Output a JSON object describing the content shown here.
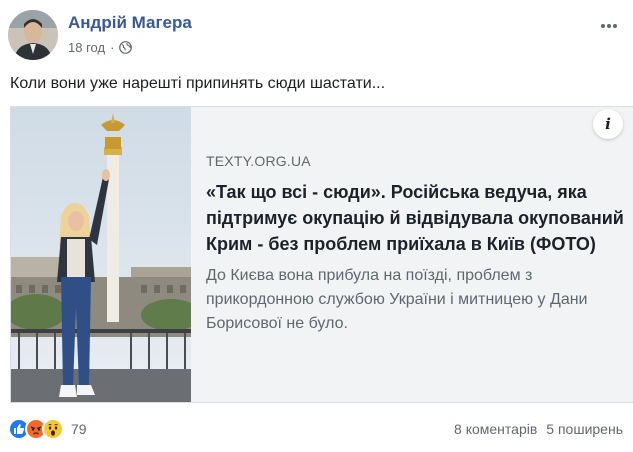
{
  "post": {
    "author": "Андрій Магера",
    "time": "18 год",
    "separator": "·",
    "audience_icon": "globe-icon",
    "more_icon": "more-options-icon",
    "text": "Коли вони уже нарешті припинять сюди шастати..."
  },
  "link_card": {
    "domain": "TEXTY.ORG.UA",
    "title": "«Так що всі - сюди». Російська ведуча, яка підтримує окупацію й відвідувала окупований Крим - без проблем приїхала в Київ (ФОТО)",
    "description": "До Києва вона прибула на поїзді, проблем з прикордонною службою України і митницею у Дани Борисової не було.",
    "info_label": "i"
  },
  "footer": {
    "reactions": [
      "like",
      "angry",
      "wow"
    ],
    "reaction_count": "79",
    "comments": "8 коментарів",
    "shares": "5 поширень"
  },
  "colors": {
    "author_link": "#385898",
    "like": "#2078f4",
    "angry": "#f0692b",
    "wow": "#f7c733",
    "card_background": "#f2f3f5"
  }
}
